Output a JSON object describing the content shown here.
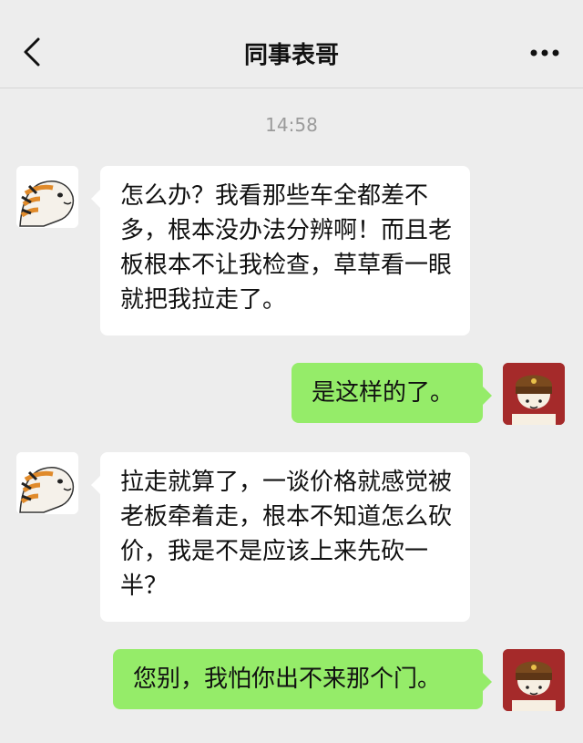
{
  "header": {
    "title": "同事表哥",
    "back_icon": "chevron-left-icon",
    "more_icon": "more-dots-icon"
  },
  "timestamp": "14:58",
  "messages": [
    {
      "sender": "contact",
      "avatar": "tiger-avatar",
      "text": "怎么办？我看那些车全都差不多，根本没办法分辨啊！而且老板根本不让我检查，草草看一眼就把我拉走了。"
    },
    {
      "sender": "me",
      "avatar": "user-avatar",
      "text": "是这样的了。"
    },
    {
      "sender": "contact",
      "avatar": "tiger-avatar",
      "text": "拉走就算了，一谈价格就感觉被老板牵着走，根本不知道怎么砍价，我是不是应该上来先砍一半？"
    },
    {
      "sender": "me",
      "avatar": "user-avatar",
      "text": "您别，我怕你出不来那个门。"
    }
  ],
  "colors": {
    "background": "#ededed",
    "incoming_bubble": "#ffffff",
    "outgoing_bubble": "#95ec69",
    "user_avatar_bg": "#a52a2a"
  }
}
